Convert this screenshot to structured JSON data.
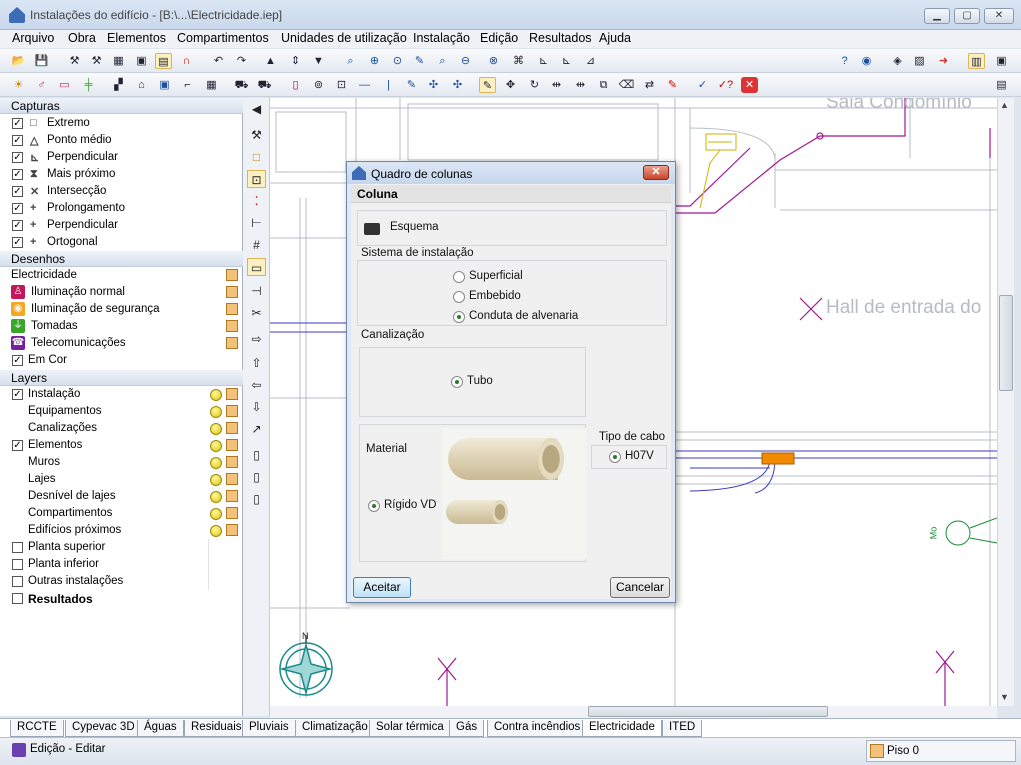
{
  "window": {
    "title": "Instalações do edifício - [B:\\...\\Electricidade.iep]",
    "min": "▁",
    "max": "▢",
    "close": "✕"
  },
  "menu": [
    "Arquivo",
    "Obra",
    "Elementos",
    "Compartimentos",
    "Unidades de utilização",
    "Instalação",
    "Edição",
    "Resultados",
    "Ajuda"
  ],
  "panel": {
    "capturas_title": "Capturas",
    "capturas": [
      {
        "label": "Extremo",
        "sym": "□",
        "checked": true
      },
      {
        "label": "Ponto médio",
        "sym": "△",
        "checked": true
      },
      {
        "label": "Perpendicular",
        "sym": "⊾",
        "checked": true
      },
      {
        "label": "Mais próximo",
        "sym": "⧗",
        "checked": true
      },
      {
        "label": "Intersecção",
        "sym": "✕",
        "checked": true
      },
      {
        "label": "Prolongamento",
        "sym": "+",
        "checked": true
      },
      {
        "label": "Perpendicular",
        "sym": "+",
        "checked": true
      },
      {
        "label": "Ortogonal",
        "sym": "+",
        "checked": true
      }
    ],
    "desenhos_title": "Desenhos",
    "desenhos_group": "Electricidade",
    "desenhos": [
      {
        "label": "Iluminação normal",
        "color": "#c2185b",
        "icon": "♙"
      },
      {
        "label": "Iluminação de segurança",
        "color": "#f5a623",
        "icon": "◉"
      },
      {
        "label": "Tomadas",
        "color": "#3aa52a",
        "icon": "⏚"
      },
      {
        "label": "Telecomunicações",
        "color": "#7b1fa2",
        "icon": "☎"
      }
    ],
    "em_cor": "Em Cor",
    "layers_title": "Layers",
    "layers": [
      {
        "label": "Instalação",
        "checked": true,
        "indent": false,
        "icons": true
      },
      {
        "label": "Equipamentos",
        "checked": null,
        "indent": true,
        "icons": true
      },
      {
        "label": "Canalizações",
        "checked": null,
        "indent": true,
        "icons": true
      },
      {
        "label": "Elementos",
        "checked": true,
        "indent": false,
        "icons": true
      },
      {
        "label": "Muros",
        "checked": null,
        "indent": true,
        "icons": true
      },
      {
        "label": "Lajes",
        "checked": null,
        "indent": true,
        "icons": true
      },
      {
        "label": "Desnível de lajes",
        "checked": null,
        "indent": true,
        "icons": true
      },
      {
        "label": "Compartimentos",
        "checked": null,
        "indent": true,
        "icons": true
      },
      {
        "label": "Edifícios próximos",
        "checked": null,
        "indent": true,
        "icons": true
      },
      {
        "label": "Planta superior",
        "checked": false,
        "indent": false,
        "icons": false
      },
      {
        "label": "Planta inferior",
        "checked": false,
        "indent": false,
        "icons": false
      },
      {
        "label": "Outras instalações",
        "checked": false,
        "indent": false,
        "icons": false
      }
    ],
    "resultados": "Resultados"
  },
  "canvas": {
    "room1": "Sala  Condomínio",
    "room2": "Hall de entrada do",
    "compass_n": "N",
    "mo": "Mo"
  },
  "dialog": {
    "title": "Quadro de colunas",
    "section": "Coluna",
    "esquema": "Esquema",
    "sistema_title": "Sistema de instalação",
    "sistema": [
      {
        "label": "Superficial",
        "selected": false
      },
      {
        "label": "Embebido",
        "selected": false
      },
      {
        "label": "Conduta de alvenaria",
        "selected": true
      }
    ],
    "canalizacao_title": "Canalização",
    "tubo": "Tubo",
    "material_title": "Material",
    "material": "Rígido VD",
    "tipo_cabo_title": "Tipo de cabo",
    "tipo_cabo": "H07V",
    "ok": "Aceitar",
    "cancel": "Cancelar"
  },
  "tabs": [
    "RCCTE",
    "Cypevac 3D",
    "Águas",
    "Residuais",
    "Pluviais",
    "Climatização",
    "Solar térmica",
    "Gás",
    "Contra incêndios",
    "Electricidade",
    "ITED"
  ],
  "active_tab": "Electricidade",
  "status": {
    "mode": "Edição - Editar",
    "floor": "Piso 0"
  }
}
